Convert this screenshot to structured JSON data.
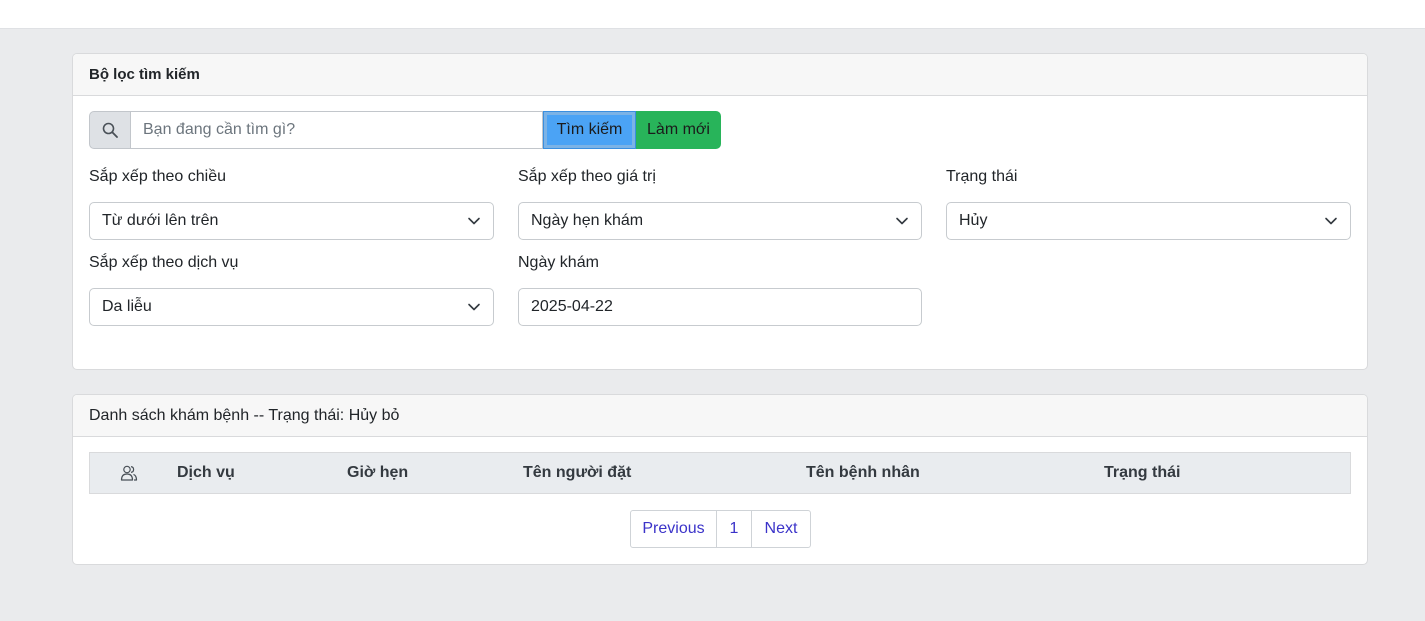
{
  "filter": {
    "title": "Bộ lọc tìm kiếm",
    "search": {
      "placeholder": "Bạn đang cần tìm gì?",
      "search_button": "Tìm kiếm",
      "refresh_button": "Làm mới"
    },
    "sort_direction": {
      "label": "Sắp xếp theo chiều",
      "value": "Từ dưới lên trên"
    },
    "sort_value": {
      "label": "Sắp xếp theo giá trị",
      "value": "Ngày hẹn khám"
    },
    "status": {
      "label": "Trạng thái",
      "value": "Hủy"
    },
    "sort_service": {
      "label": "Sắp xếp theo dịch vụ",
      "value": "Da liễu"
    },
    "exam_date": {
      "label": "Ngày khám",
      "value": "2025-04-22"
    }
  },
  "list": {
    "title": "Danh sách khám bệnh -- Trạng thái: Hủy bỏ",
    "columns": [
      "Dịch vụ",
      "Giờ hẹn",
      "Tên người đặt",
      "Tên bệnh nhân",
      "Trạng thái"
    ],
    "pagination": {
      "previous": "Previous",
      "page": "1",
      "next": "Next"
    }
  },
  "colors": {
    "search_button": "#4ba3f5",
    "refresh_button": "#28b45a",
    "link": "#3b33c9"
  }
}
